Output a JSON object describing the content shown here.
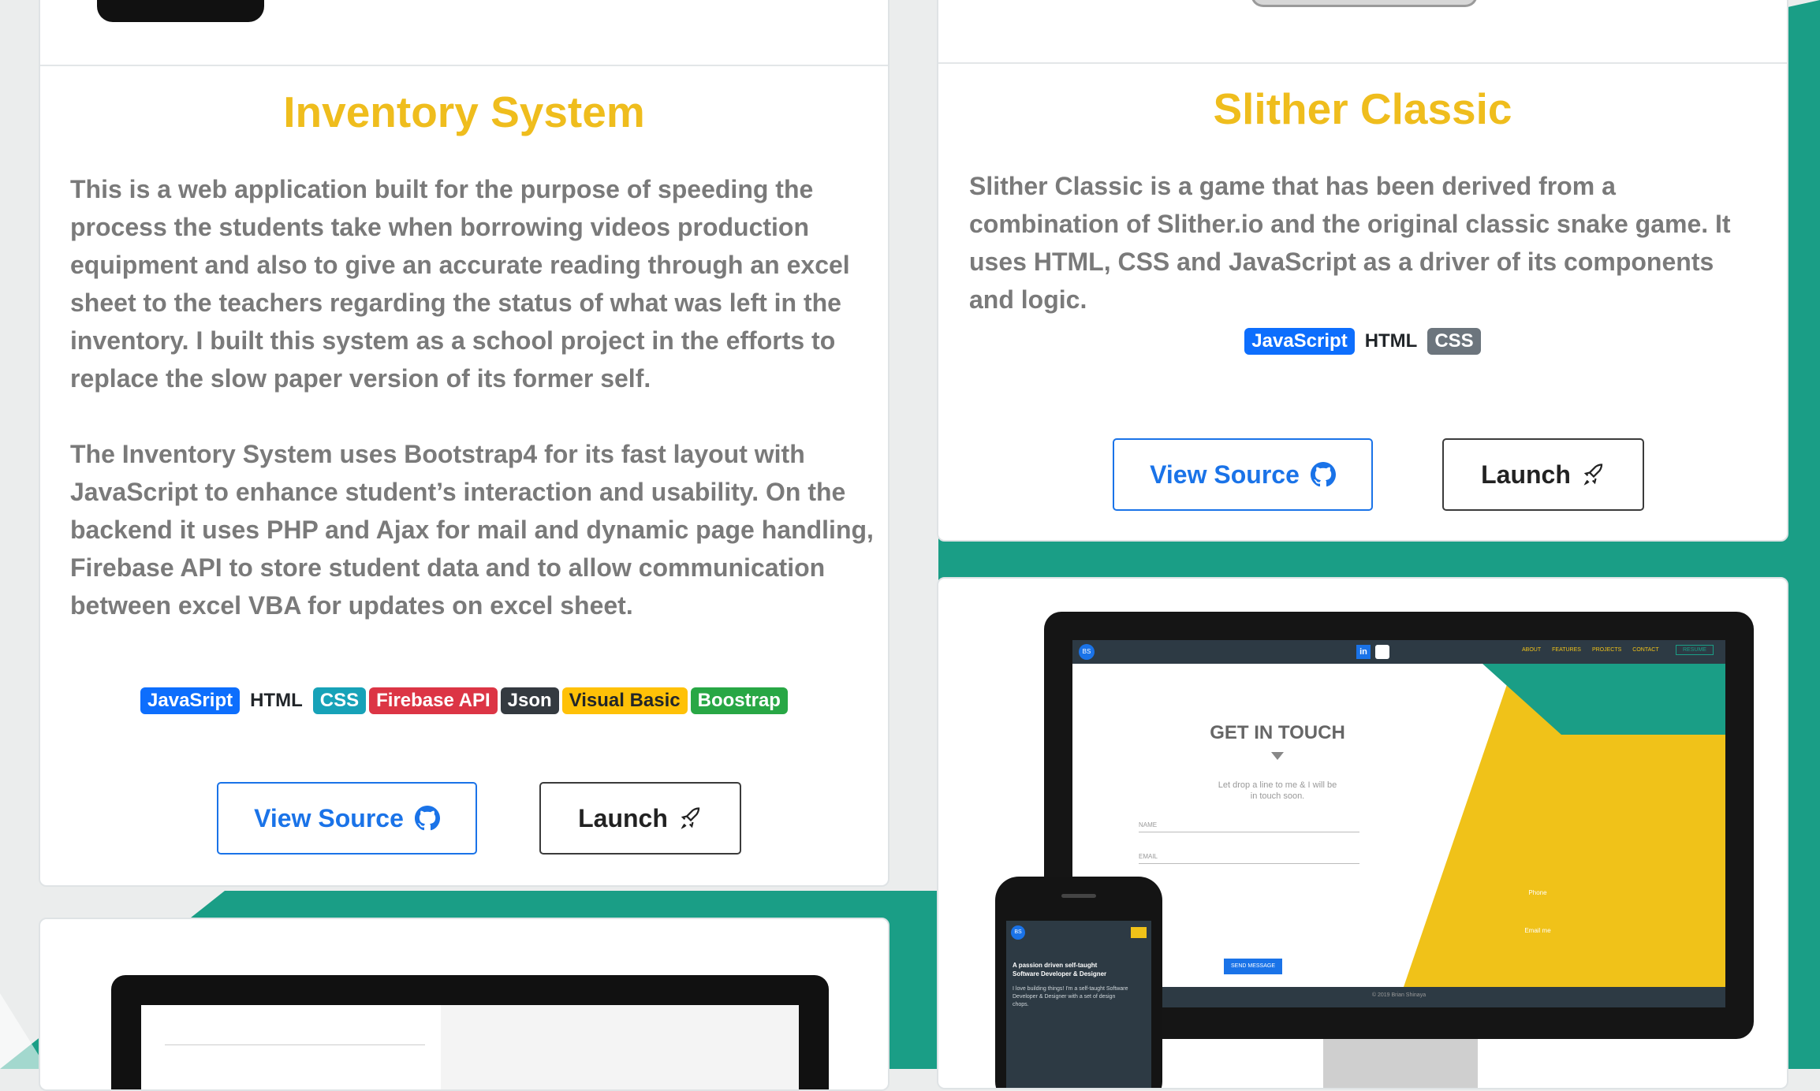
{
  "colors": {
    "teal": "#1a9e86",
    "yellow": "#efbd1d",
    "blue": "#0d6efd"
  },
  "cards": [
    {
      "title": "Inventory System",
      "paragraph1": "This is a web application built for the purpose of speeding the process the students take when borrowing videos production equipment and also to give an accurate reading through an excel sheet to the teachers regarding the status of what was left in the inventory. I built this system as a school project in the efforts to replace the slow paper version of its former self.",
      "paragraph2": "The Inventory System uses Bootstrap4 for its fast layout with JavaScript to enhance student’s interaction and usability. On the backend it uses PHP and Ajax for mail and dynamic page handling, Firebase API to store student data and to allow communication between excel VBA for updates on excel sheet.",
      "tags": [
        {
          "label": "JavaSript",
          "color": "#0d6efd"
        },
        {
          "label": "HTML",
          "color": "plain"
        },
        {
          "label": "CSS",
          "color": "#17a2b8"
        },
        {
          "label": "Firebase API",
          "color": "#dc3545"
        },
        {
          "label": "Json",
          "color": "#343a40"
        },
        {
          "label": "Visual Basic",
          "color": "#ffc107"
        },
        {
          "label": "Boostrap",
          "color": "#28a745"
        }
      ],
      "view_source": "View Source",
      "launch": "Launch"
    },
    {
      "title": "Slither Classic",
      "paragraph1": "Slither Classic is a game that has been derived from a combination of Slither.io and the original classic snake game. It uses HTML, CSS and JavaScript as a driver of its components and logic.",
      "tags": [
        {
          "label": "JavaScript",
          "color": "#0d6efd"
        },
        {
          "label": "HTML",
          "color": "plain"
        },
        {
          "label": "CSS",
          "color": "#6c757d"
        }
      ],
      "view_source": "View Source",
      "launch": "Launch"
    }
  ],
  "preview": {
    "heading": "GET IN TOUCH",
    "subtext_line1": "Let drop a line to me & I will be",
    "subtext_line2": "in touch soon.",
    "field_name": "NAME",
    "field_email": "EMAIL",
    "send_button": "SEND MESSAGE",
    "nav_items": [
      "ABOUT",
      "FEATURES",
      "PROJECTS",
      "CONTACT"
    ],
    "resume": "RESUME",
    "logo": "BS",
    "phone_label": "Phone",
    "email_label": "Email me",
    "footer": "© 2019 Brian Shinaya",
    "mobile_tagline_line1": "A passion driven self-taught",
    "mobile_tagline_line2": "Software Developer & Designer",
    "mobile_text": "I love building things! I'm a self-taught Software Developer & Designer with a set of design chops."
  }
}
